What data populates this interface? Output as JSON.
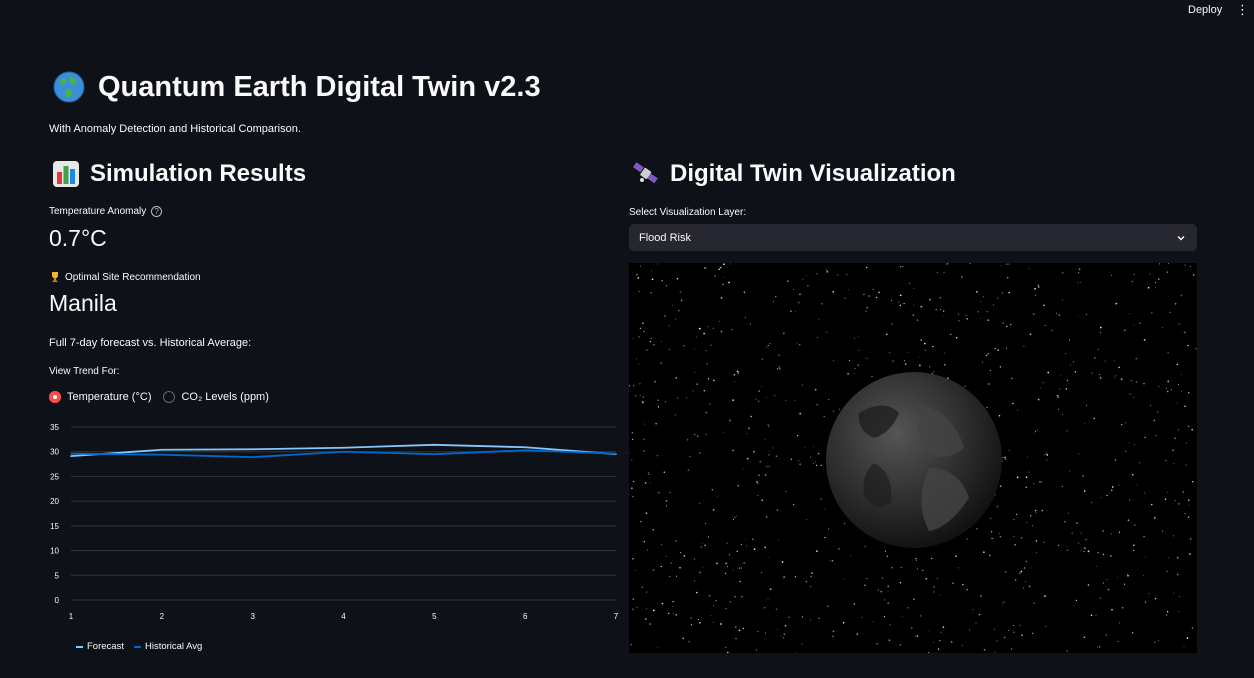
{
  "header": {
    "deploy_label": "Deploy",
    "menu_icon": "kebab-menu-icon"
  },
  "page": {
    "title": "Quantum Earth Digital Twin v2.3",
    "title_icon": "globe-icon",
    "subtitle": "With Anomaly Detection and Historical Comparison."
  },
  "left": {
    "heading": "Simulation Results",
    "heading_icon": "bar-chart-icon",
    "metric1": {
      "label": "Temperature Anomaly",
      "value": "0.7°C"
    },
    "metric2": {
      "label": "Optimal Site Recommendation",
      "value": "Manila",
      "icon": "trophy-icon"
    },
    "forecast_caption": "Full 7-day forecast vs. Historical Average:",
    "trend_label": "View Trend For:",
    "radio": {
      "options": [
        "Temperature (°C)",
        "CO₂ Levels (ppm)"
      ],
      "selected": "Temperature (°C)"
    }
  },
  "right": {
    "heading": "Digital Twin Visualization",
    "heading_icon": "satellite-icon",
    "select_label": "Select Visualization Layer:",
    "select_value": "Flood Risk"
  },
  "chart_data": {
    "type": "line",
    "x": [
      1,
      2,
      3,
      4,
      5,
      6,
      7
    ],
    "ylim": [
      0,
      35
    ],
    "yticks": [
      0,
      5,
      10,
      15,
      20,
      25,
      30,
      35
    ],
    "series": [
      {
        "name": "Forecast",
        "values": [
          29.1,
          30.4,
          30.5,
          30.8,
          31.4,
          30.9,
          29.5
        ],
        "color": "#83c9ff"
      },
      {
        "name": "Historical Avg",
        "values": [
          29.6,
          29.4,
          28.9,
          30.0,
          29.5,
          30.3,
          29.6
        ],
        "color": "#0068c9"
      }
    ],
    "legend_position": "bottom-left",
    "grid": true
  },
  "colors": {
    "accent": "#ff4b4b",
    "background": "#0e1117",
    "select_bg": "#262730"
  }
}
